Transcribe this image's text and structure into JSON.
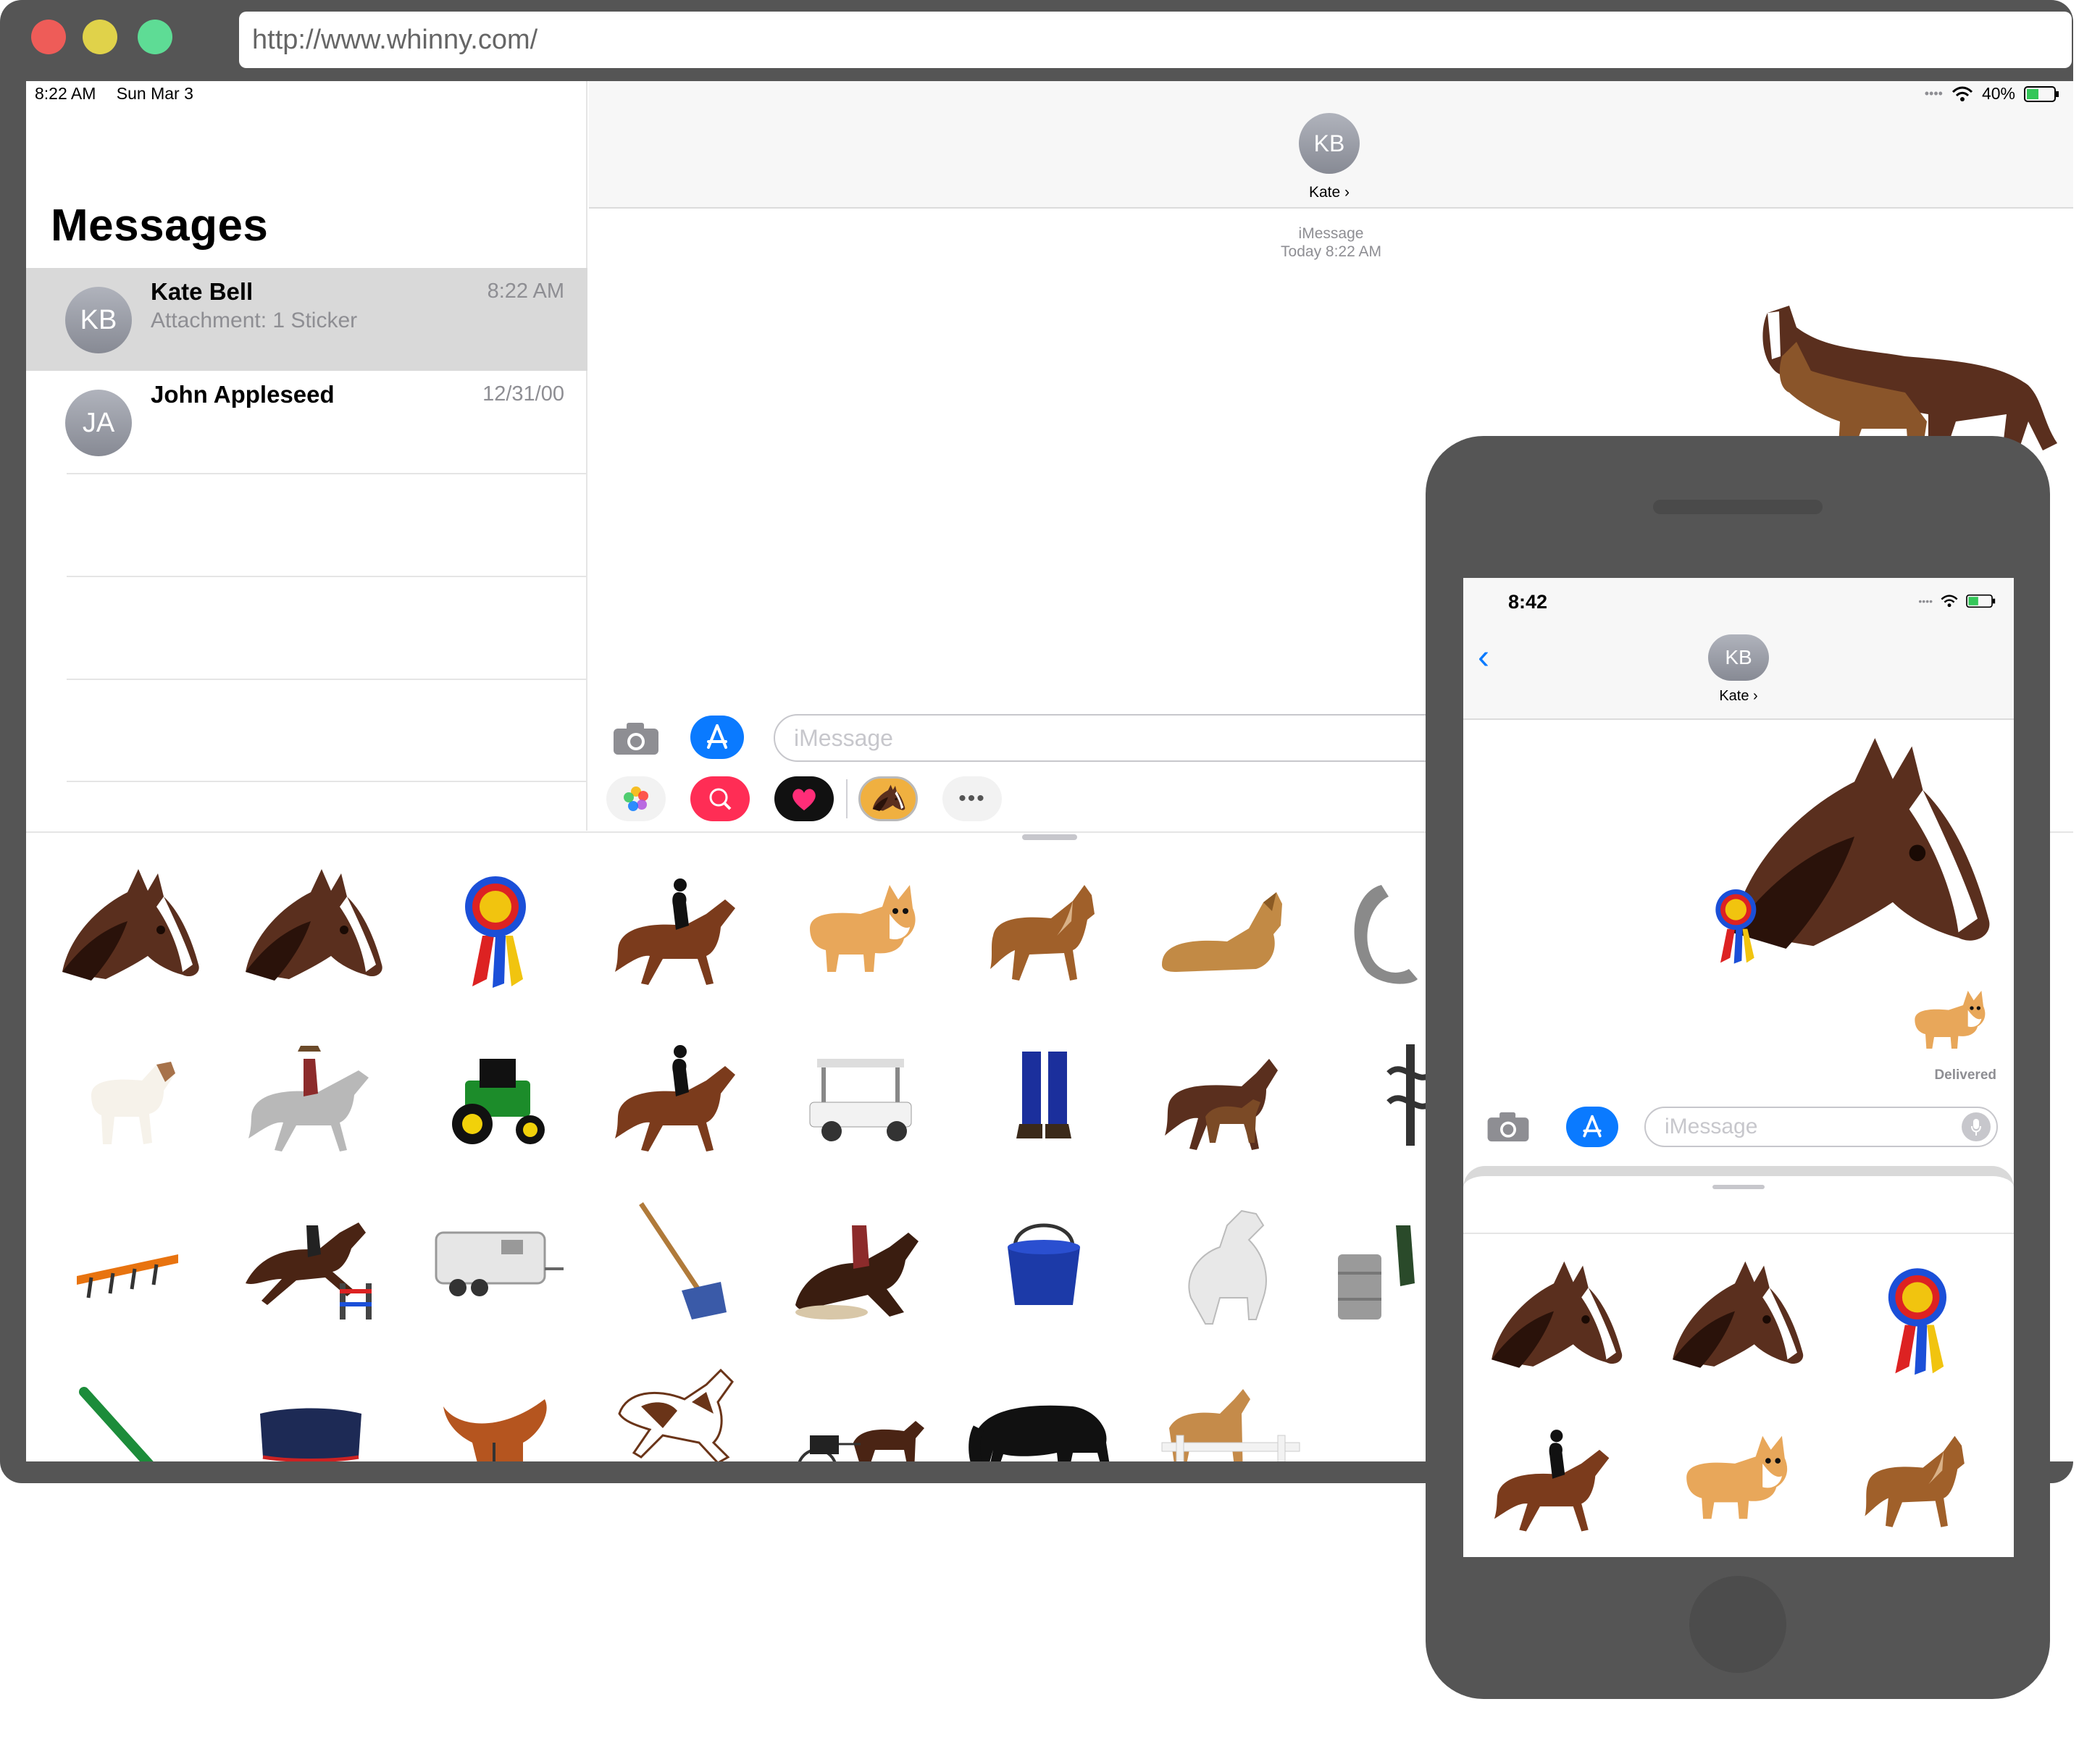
{
  "browser": {
    "url": "http://www.whinny.com/",
    "traffic_lights": {
      "close": "#ee5c58",
      "minimize": "#e0d24a",
      "maximize": "#5edc95"
    }
  },
  "ipad": {
    "status": {
      "time": "8:22 AM",
      "date": "Sun Mar 3",
      "battery": "40%"
    },
    "title": "Messages",
    "conversations": [
      {
        "initials": "KB",
        "name": "Kate Bell",
        "preview": "Attachment: 1 Sticker",
        "time": "8:22 AM",
        "selected": true
      },
      {
        "initials": "JA",
        "name": "John Appleseed",
        "preview": "",
        "time": "12/31/00",
        "selected": false
      }
    ],
    "chat": {
      "initials": "KB",
      "contact": "Kate ›",
      "service": "iMessage",
      "timestamp": "Today 8:22 AM",
      "placeholder": "iMessage"
    },
    "app_strip": [
      "photos-app",
      "image-search-app",
      "digital-touch-app",
      "whinny-sticker-app",
      "more-apps"
    ],
    "stickers": [
      "horse-head",
      "horse-head-alt",
      "rosette-ribbon",
      "dressage-rider",
      "corgi",
      "pony",
      "lying-foal",
      "horseshoe",
      "jack-russell-terrier",
      "western-rider",
      "tractor",
      "dressage-horse",
      "golf-cart",
      "leg-wraps",
      "mare-and-foal",
      "vet-symbol",
      "harrow",
      "show-jumper",
      "horse-trailer",
      "manure-fork",
      "reining-horse",
      "feed-bucket",
      "white-horse",
      "barrel-racer",
      "hoof-pick",
      "horse-blanket",
      "saddle",
      "bucking-pinto",
      "carriage-driving",
      "grazing-horse",
      "horse-at-fence"
    ]
  },
  "iphone": {
    "status": {
      "time": "8:42"
    },
    "chat": {
      "initials": "KB",
      "contact": "Kate ›",
      "delivered": "Delivered",
      "placeholder": "iMessage"
    },
    "stickers": [
      "horse-head",
      "horse-head-alt",
      "rosette-ribbon",
      "dressage-rider",
      "corgi",
      "pony"
    ]
  }
}
